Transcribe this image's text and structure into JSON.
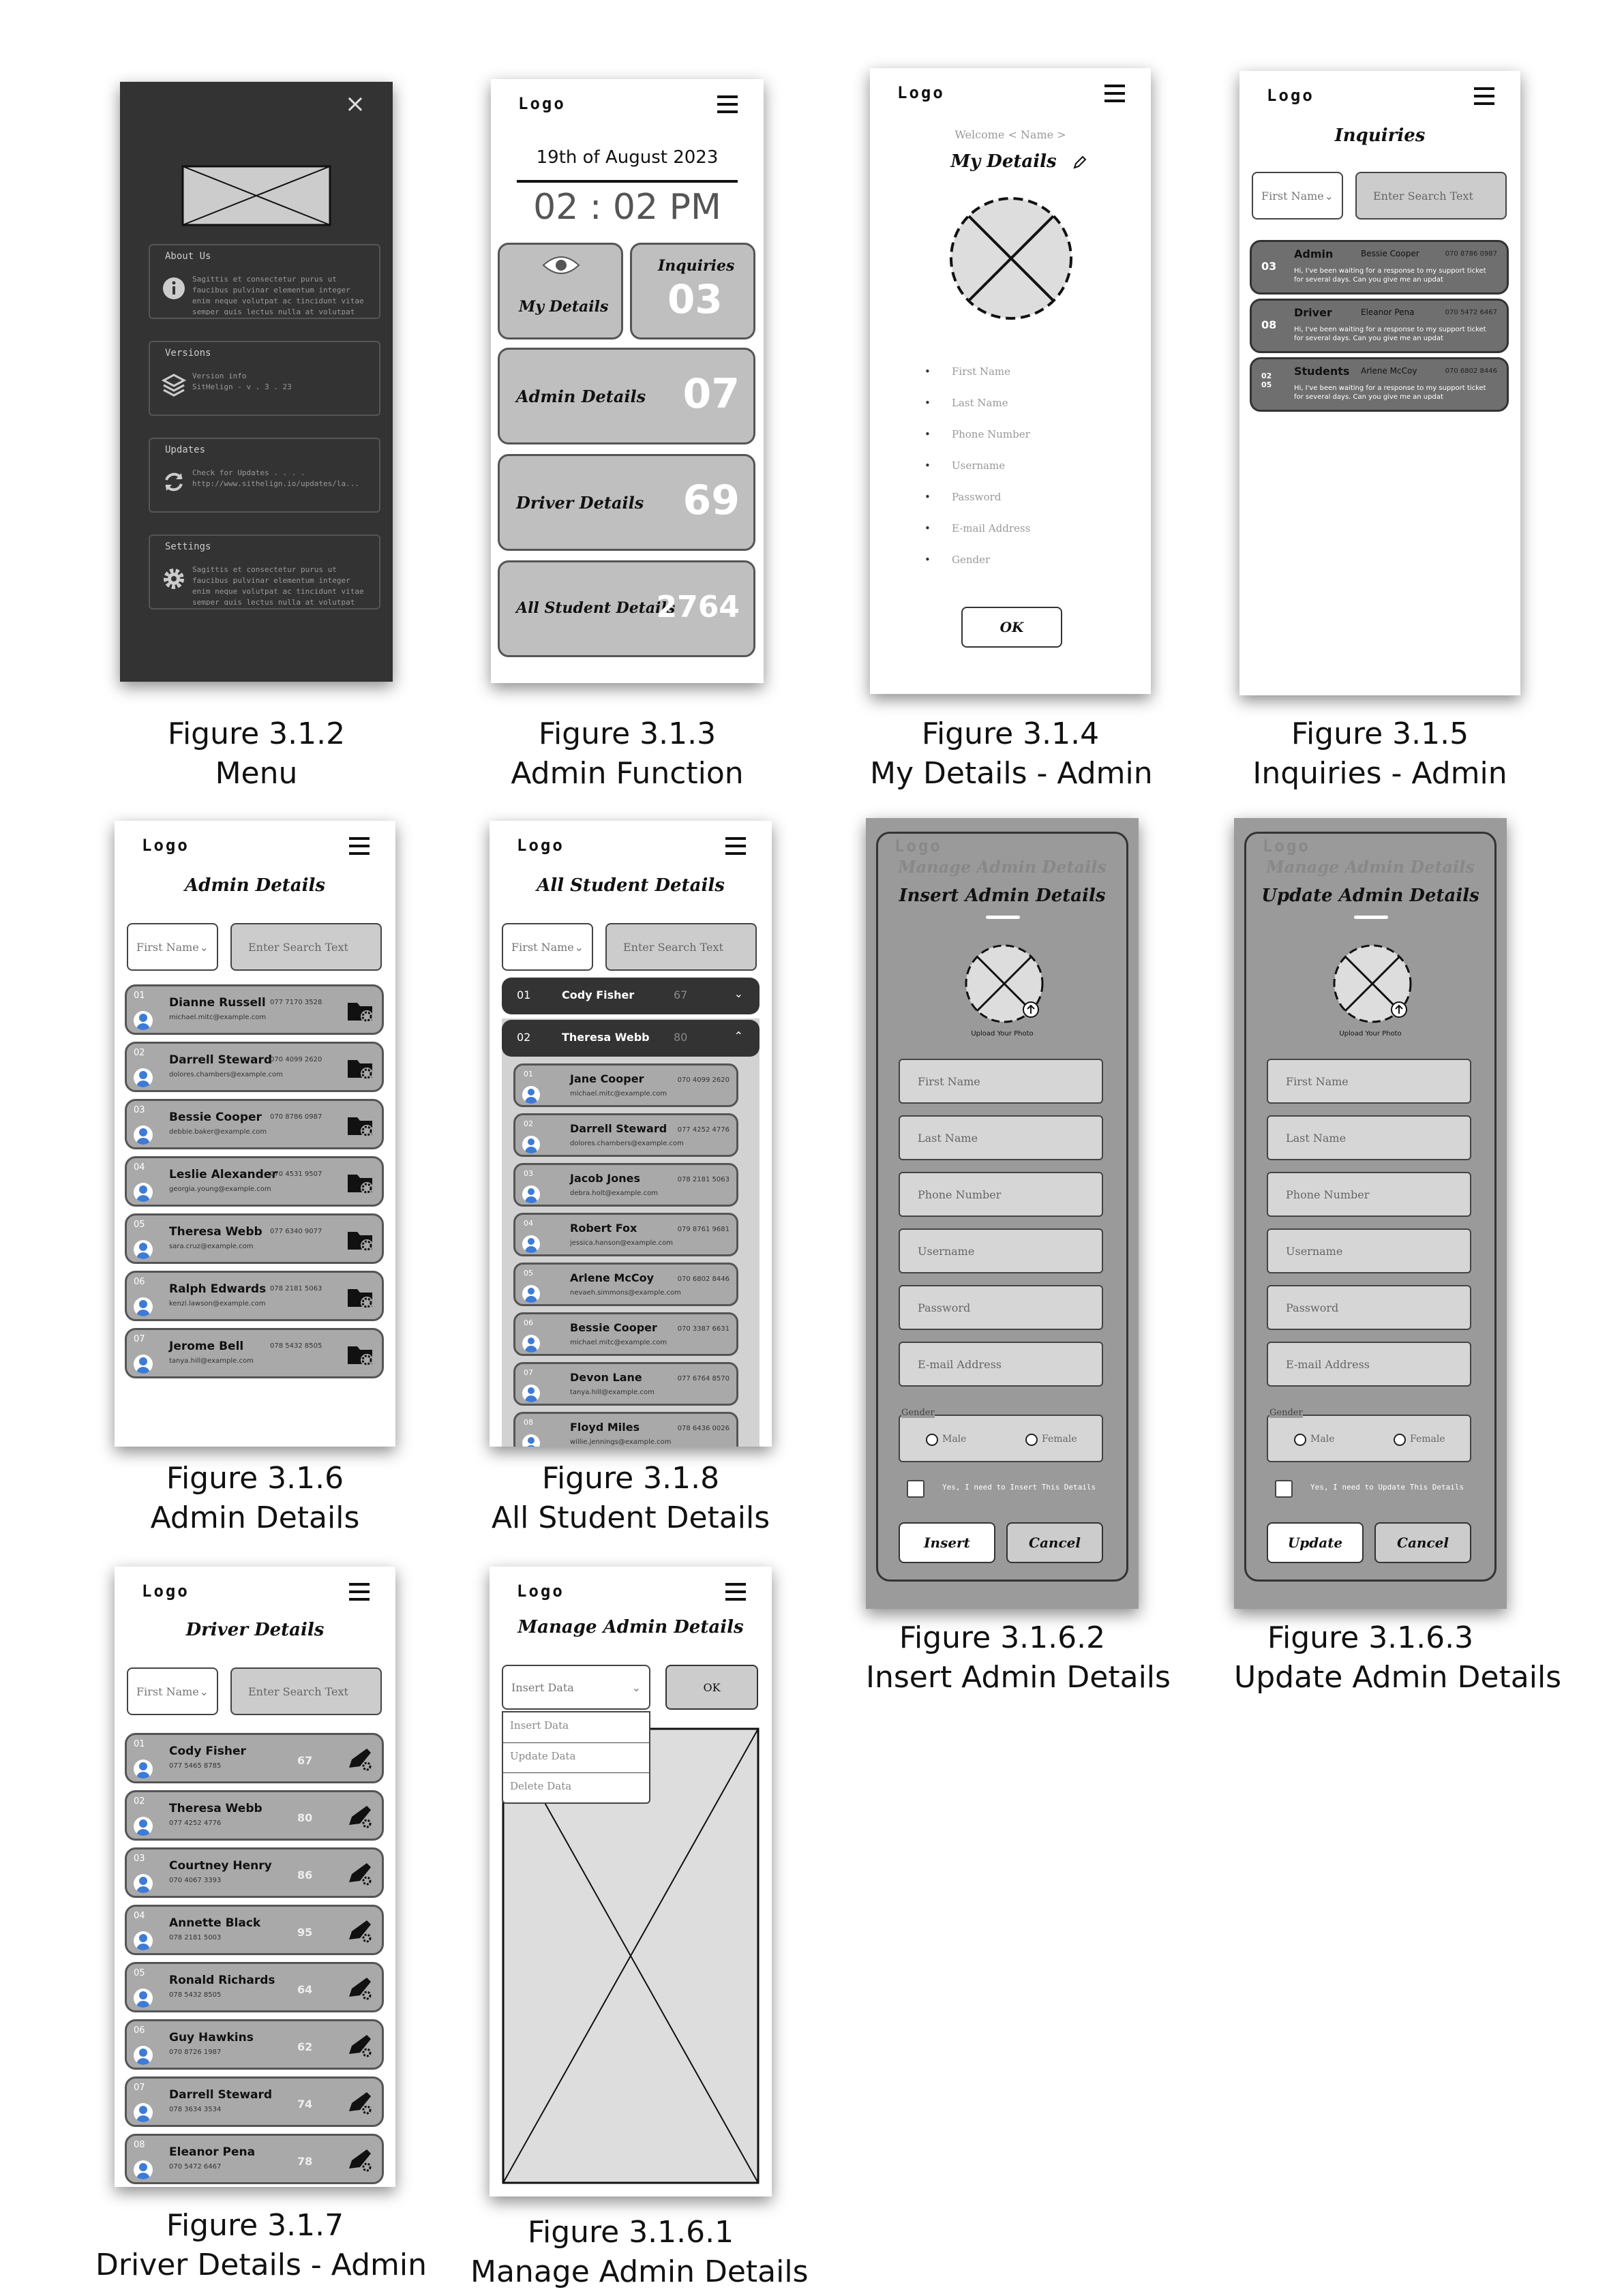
{
  "captions": {
    "f312": {
      "num": "Figure 3.1.2",
      "name": "Menu"
    },
    "f313": {
      "num": "Figure 3.1.3",
      "name": "Admin Function"
    },
    "f314": {
      "num": "Figure 3.1.4",
      "name": "My Details - Admin"
    },
    "f315": {
      "num": "Figure 3.1.5",
      "name": "Inquiries - Admin"
    },
    "f316": {
      "num": "Figure 3.1.6",
      "name": "Admin Details"
    },
    "f318": {
      "num": "Figure 3.1.8",
      "name": "All Student Details"
    },
    "f3162": {
      "num": "Figure 3.1.6.2",
      "name": "Insert Admin Details"
    },
    "f3163": {
      "num": "Figure 3.1.6.3",
      "name": "Update Admin Details"
    },
    "f317": {
      "num": "Figure 3.1.7",
      "name": "Driver Details - Admin"
    },
    "f3161": {
      "num": "Figure 3.1.6.1",
      "name": "Manage Admin Details"
    }
  },
  "common": {
    "logo": "Logo",
    "first_name_select": "First Name",
    "search_placeholder": "Enter Search Text",
    "ok": "OK"
  },
  "menu": {
    "close": "×",
    "items": [
      {
        "title": "About Us",
        "desc": "Sagittis et consectetur purus ut faucibus pulvinar elementum integer enim neque volutpat ac tincidunt vitae semper quis lectus nulla at volutpat diam ut venenatis.",
        "icon": "info-icon"
      },
      {
        "title": "Versions",
        "desc": "Version info\nSitHelign - v . 3 . 23",
        "icon": "layers-icon"
      },
      {
        "title": "Updates",
        "desc": "Check for Updates . . . .\nhttp://www.sithelign.io/updates/la...",
        "icon": "refresh-icon"
      },
      {
        "title": "Settings",
        "desc": "Sagittis et consectetur purus ut faucibus pulvinar elementum integer enim neque volutpat ac tincidunt vitae semper quis lectus nulla at volutpat diam ut venenatis.",
        "icon": "gear-icon"
      }
    ]
  },
  "admin_fn": {
    "date": "19th of August 2023",
    "time": "02 : 02 PM",
    "my_details": "My Details",
    "inquiries": "Inquiries",
    "inquiries_count": "03",
    "admin_details": "Admin Details",
    "admin_count": "07",
    "driver_details": "Driver Details",
    "driver_count": "69",
    "student_details": "All Student Details",
    "student_count": "2764"
  },
  "my_details": {
    "welcome": "Welcome < Name >",
    "title": "My Details",
    "fields": [
      "First Name",
      "Last Name",
      "Phone Number",
      "Username",
      "Password",
      "E-mail Address",
      "Gender"
    ],
    "ok": "OK"
  },
  "inquiries": {
    "title": "Inquiries",
    "items": [
      {
        "num": "03",
        "role": "Admin",
        "name": "Bessie Cooper",
        "phone": "070 8786 0987",
        "msg": "Hi, I've been waiting for a response to my support ticket for several days. Can you give me an updat"
      },
      {
        "num": "08",
        "role": "Driver",
        "name": "Eleanor Pena",
        "phone": "070 5472 6467",
        "msg": "Hi, I've been waiting for a response to my support ticket for several days. Can you give me an updat"
      },
      {
        "num": "02\n05",
        "role": "Students",
        "name": "Arlene McCoy",
        "phone": "070 6802 8446",
        "msg": "Hi, I've been waiting for a response to my support ticket for several days. Can you give me an updat"
      }
    ]
  },
  "admin_details": {
    "title": "Admin Details",
    "rows": [
      {
        "num": "01",
        "name": "Dianne Russell",
        "phone": "077 7170 3528",
        "email": "michael.mitc@example.com"
      },
      {
        "num": "02",
        "name": "Darrell Steward",
        "phone": "070 4099 2620",
        "email": "dolores.chambers@example.com"
      },
      {
        "num": "03",
        "name": "Bessie Cooper",
        "phone": "070 8786 0987",
        "email": "debbie.baker@example.com"
      },
      {
        "num": "04",
        "name": "Leslie Alexander",
        "phone": "070 4531 9507",
        "email": "georgia.young@example.com"
      },
      {
        "num": "05",
        "name": "Theresa Webb",
        "phone": "077 6340 9077",
        "email": "sara.cruz@example.com"
      },
      {
        "num": "06",
        "name": "Ralph Edwards",
        "phone": "078 2181 5063",
        "email": "kenzi.lawson@example.com"
      },
      {
        "num": "07",
        "name": "Jerome Bell",
        "phone": "078 5432 8505",
        "email": "tanya.hill@example.com"
      }
    ]
  },
  "students": {
    "title": "All Student Details",
    "groups": [
      {
        "num": "01",
        "name": "Cody Fisher",
        "score": "67",
        "chev": "⌄"
      },
      {
        "num": "02",
        "name": "Theresa Webb",
        "score": "80",
        "chev": "⌃"
      }
    ],
    "rows": [
      {
        "num": "01",
        "name": "Jane Cooper",
        "phone": "070 4099 2620",
        "email": "michael.mitc@example.com"
      },
      {
        "num": "02",
        "name": "Darrell Steward",
        "phone": "077 4252 4776",
        "email": "dolores.chambers@example.com"
      },
      {
        "num": "03",
        "name": "Jacob Jones",
        "phone": "078 2181 5063",
        "email": "debra.holt@example.com"
      },
      {
        "num": "04",
        "name": "Robert Fox",
        "phone": "079 8761 9681",
        "email": "jessica.hanson@example.com"
      },
      {
        "num": "05",
        "name": "Arlene McCoy",
        "phone": "070 6802 8446",
        "email": "nevaeh.simmons@example.com"
      },
      {
        "num": "06",
        "name": "Bessie Cooper",
        "phone": "070 3387 6631",
        "email": "michael.mitc@example.com"
      },
      {
        "num": "07",
        "name": "Devon Lane",
        "phone": "077 6764 8570",
        "email": "tanya.hill@example.com"
      },
      {
        "num": "08",
        "name": "Floyd Miles",
        "phone": "078 6436 0026",
        "email": "willie.jennings@example.com"
      }
    ]
  },
  "insert": {
    "bg_title": "Manage Admin Details",
    "title": "Insert Admin Details",
    "upload": "Upload Your Photo",
    "fields": [
      "First Name",
      "Last Name",
      "Phone Number",
      "Username",
      "Password",
      "E-mail Address"
    ],
    "gender": "Gender",
    "male": "Male",
    "female": "Female",
    "confirm": "Yes, I need to Insert This Details",
    "action": "Insert",
    "cancel": "Cancel"
  },
  "update": {
    "bg_title": "Manage Admin Details",
    "title": "Update Admin Details",
    "upload": "Upload Your Photo",
    "fields": [
      "First Name",
      "Last Name",
      "Phone Number",
      "Username",
      "Password",
      "E-mail Address"
    ],
    "gender": "Gender",
    "male": "Male",
    "female": "Female",
    "confirm": "Yes, I need to Update This Details",
    "action": "Update",
    "cancel": "Cancel"
  },
  "drivers": {
    "title": "Driver Details",
    "rows": [
      {
        "num": "01",
        "name": "Cody Fisher",
        "phone": "077 5465 8785",
        "score": "67"
      },
      {
        "num": "02",
        "name": "Theresa Webb",
        "phone": "077 4252 4776",
        "score": "80"
      },
      {
        "num": "03",
        "name": "Courtney Henry",
        "phone": "070 4067 3393",
        "score": "86"
      },
      {
        "num": "04",
        "name": "Annette Black",
        "phone": "078 2181 5003",
        "score": "95"
      },
      {
        "num": "05",
        "name": "Ronald Richards",
        "phone": "078 5432 8505",
        "score": "64"
      },
      {
        "num": "06",
        "name": "Guy Hawkins",
        "phone": "070 8726 1987",
        "score": "62"
      },
      {
        "num": "07",
        "name": "Darrell Steward",
        "phone": "078 3634 3534",
        "score": "74"
      },
      {
        "num": "08",
        "name": "Eleanor Pena",
        "phone": "070 5472 6467",
        "score": "78"
      }
    ]
  },
  "manage": {
    "title": "Manage Admin Details",
    "select": "Insert Data",
    "options": [
      "Insert Data",
      "Update Data",
      "Delete Data"
    ],
    "ok": "OK"
  }
}
